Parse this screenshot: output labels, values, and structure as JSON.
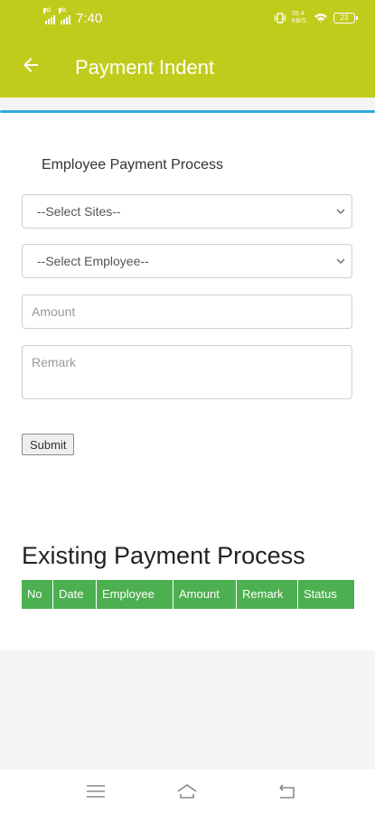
{
  "status_bar": {
    "network_1": "4G",
    "network_2": "4G",
    "time": "7:40",
    "speed": "55.4 KB/S",
    "battery": "23"
  },
  "app_bar": {
    "title": "Payment Indent",
    "back_icon": "arrow-left-icon"
  },
  "form": {
    "heading": "Employee Payment Process",
    "site_select": "--Select Sites--",
    "employee_select": "--Select Employee--",
    "amount_placeholder": "Amount",
    "remark_placeholder": "Remark",
    "submit_label": "Submit"
  },
  "existing": {
    "heading": "Existing Payment Process",
    "columns": [
      "No",
      "Date",
      "Employee",
      "Amount",
      "Remark",
      "Status"
    ]
  },
  "colors": {
    "app_bar": "#c0cc1c",
    "accent_line": "#2ea8e0",
    "table_header": "#4caf50"
  },
  "nav_bar": {
    "icons": [
      "menu-icon",
      "home-icon",
      "back-icon"
    ]
  }
}
